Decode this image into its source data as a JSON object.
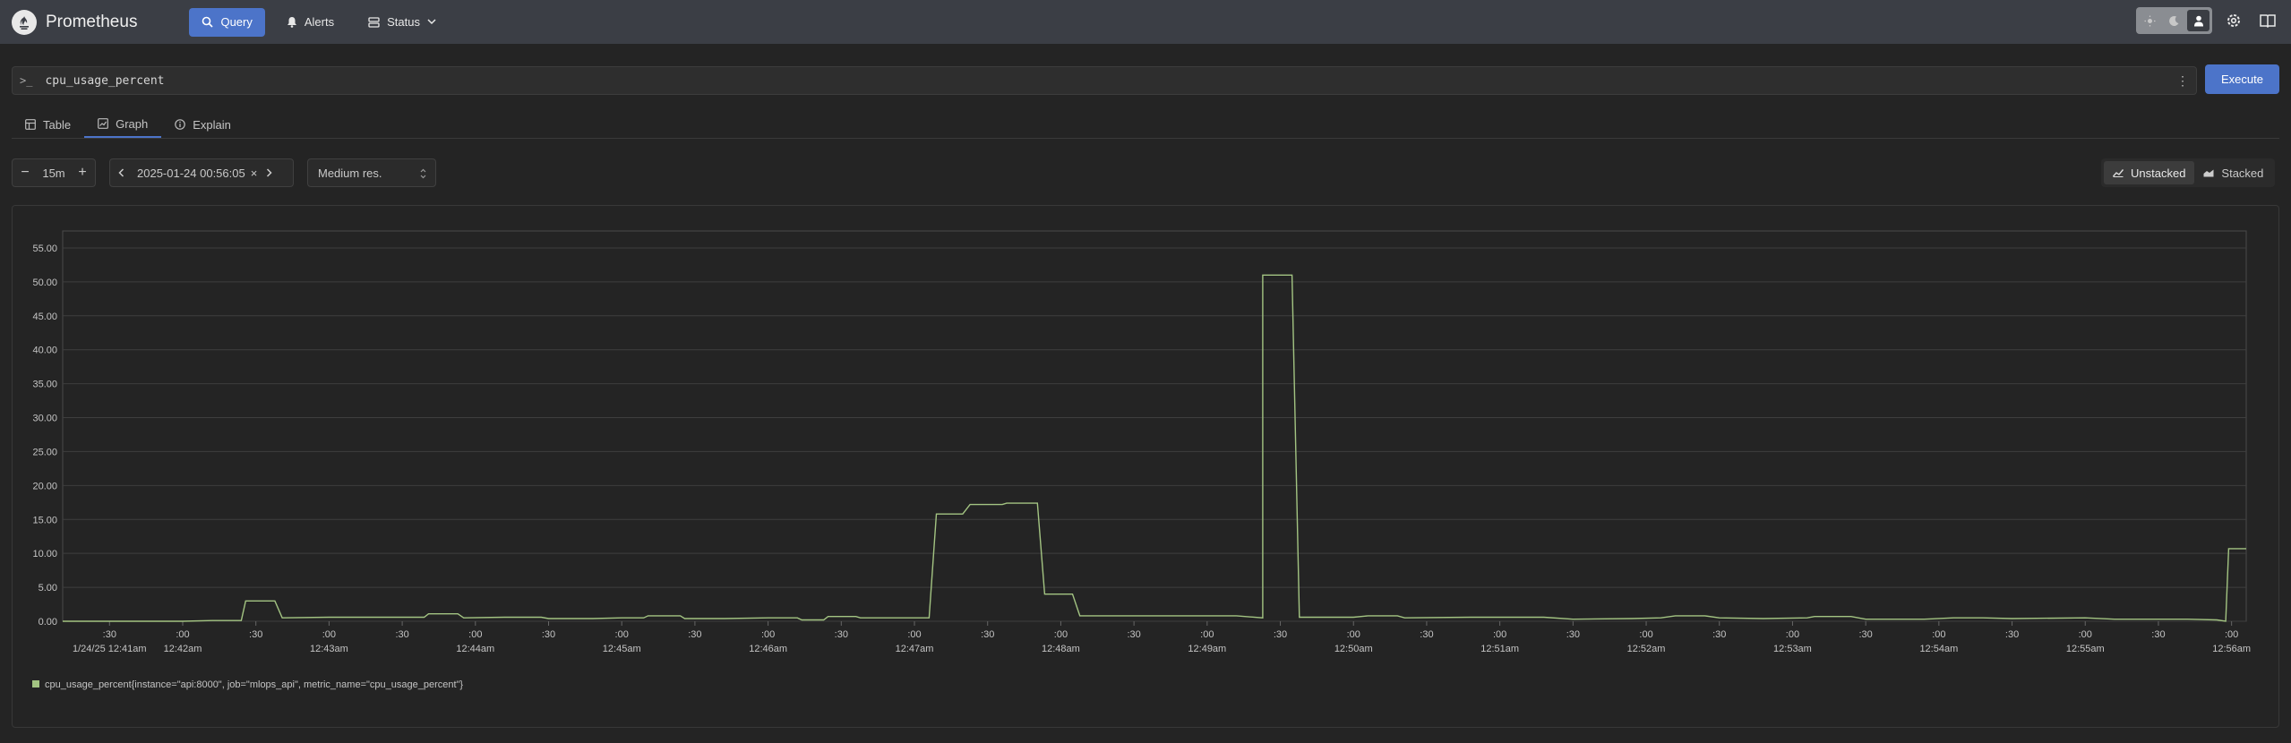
{
  "app": {
    "title": "Prometheus"
  },
  "nav": {
    "query": "Query",
    "alerts": "Alerts",
    "status": "Status"
  },
  "theme": {
    "modes": [
      "light-icon",
      "dark-icon",
      "auto-icon"
    ],
    "selected": "auto"
  },
  "expression": {
    "prompt": ">_",
    "value": "cpu_usage_percent"
  },
  "execute_label": "Execute",
  "tabs": [
    {
      "label": "Table",
      "icon": "table-icon"
    },
    {
      "label": "Graph",
      "icon": "graph-icon",
      "active": true
    },
    {
      "label": "Explain",
      "icon": "info-icon"
    }
  ],
  "controls": {
    "range": "15m",
    "end_time": "2025-01-24 00:56:05",
    "resolution": "Medium res.",
    "unstacked": "Unstacked",
    "stacked": "Stacked",
    "stack_mode": "Unstacked"
  },
  "colors": {
    "accent": "#4c74c9",
    "series": "#a3c482"
  },
  "chart_data": {
    "type": "line",
    "ylim": [
      0,
      57.5
    ],
    "yticks": [
      "0.00",
      "5.00",
      "10.00",
      "15.00",
      "20.00",
      "25.00",
      "30.00",
      "35.00",
      "40.00",
      "45.00",
      "50.00",
      "55.00"
    ],
    "xticks": [
      {
        "t": 0.5,
        "top": ":30",
        "bottom": "1/24/25 12:41am"
      },
      {
        "t": 1.0,
        "top": ":00",
        "bottom": "12:42am"
      },
      {
        "t": 1.5,
        "top": ":30",
        "bottom": ""
      },
      {
        "t": 2.0,
        "top": ":00",
        "bottom": "12:43am"
      },
      {
        "t": 2.5,
        "top": ":30",
        "bottom": ""
      },
      {
        "t": 3.0,
        "top": ":00",
        "bottom": "12:44am"
      },
      {
        "t": 3.5,
        "top": ":30",
        "bottom": ""
      },
      {
        "t": 4.0,
        "top": ":00",
        "bottom": "12:45am"
      },
      {
        "t": 4.5,
        "top": ":30",
        "bottom": ""
      },
      {
        "t": 5.0,
        "top": ":00",
        "bottom": "12:46am"
      },
      {
        "t": 5.5,
        "top": ":30",
        "bottom": ""
      },
      {
        "t": 6.0,
        "top": ":00",
        "bottom": "12:47am"
      },
      {
        "t": 6.5,
        "top": ":30",
        "bottom": ""
      },
      {
        "t": 7.0,
        "top": ":00",
        "bottom": "12:48am"
      },
      {
        "t": 7.5,
        "top": ":30",
        "bottom": ""
      },
      {
        "t": 8.0,
        "top": ":00",
        "bottom": "12:49am"
      },
      {
        "t": 8.5,
        "top": ":30",
        "bottom": ""
      },
      {
        "t": 9.0,
        "top": ":00",
        "bottom": "12:50am"
      },
      {
        "t": 9.5,
        "top": ":30",
        "bottom": ""
      },
      {
        "t": 10.0,
        "top": ":00",
        "bottom": "12:51am"
      },
      {
        "t": 10.5,
        "top": ":30",
        "bottom": ""
      },
      {
        "t": 11.0,
        "top": ":00",
        "bottom": "12:52am"
      },
      {
        "t": 11.5,
        "top": ":30",
        "bottom": ""
      },
      {
        "t": 12.0,
        "top": ":00",
        "bottom": "12:53am"
      },
      {
        "t": 12.5,
        "top": ":30",
        "bottom": ""
      },
      {
        "t": 13.0,
        "top": ":00",
        "bottom": "12:54am"
      },
      {
        "t": 13.5,
        "top": ":30",
        "bottom": ""
      },
      {
        "t": 14.0,
        "top": ":00",
        "bottom": "12:55am"
      },
      {
        "t": 14.5,
        "top": ":30",
        "bottom": ""
      },
      {
        "t": 15.0,
        "top": ":00",
        "bottom": "12:56am"
      }
    ],
    "x_domain": [
      0.18,
      15.1
    ],
    "series": [
      {
        "name": "cpu_usage_percent{instance=\"api:8000\", job=\"mlops_api\", metric_name=\"cpu_usage_percent\"}",
        "points": [
          [
            0.18,
            0.0
          ],
          [
            1.0,
            0.0
          ],
          [
            1.2,
            0.1
          ],
          [
            1.4,
            0.1
          ],
          [
            1.43,
            3.0
          ],
          [
            1.63,
            3.0
          ],
          [
            1.68,
            0.5
          ],
          [
            2.0,
            0.6
          ],
          [
            2.5,
            0.6
          ],
          [
            2.65,
            0.6
          ],
          [
            2.68,
            1.1
          ],
          [
            2.88,
            1.1
          ],
          [
            2.92,
            0.5
          ],
          [
            3.2,
            0.6
          ],
          [
            3.45,
            0.6
          ],
          [
            3.5,
            0.4
          ],
          [
            3.8,
            0.4
          ],
          [
            4.0,
            0.5
          ],
          [
            4.15,
            0.5
          ],
          [
            4.18,
            0.8
          ],
          [
            4.4,
            0.8
          ],
          [
            4.43,
            0.4
          ],
          [
            4.7,
            0.4
          ],
          [
            5.0,
            0.5
          ],
          [
            5.2,
            0.5
          ],
          [
            5.23,
            0.2
          ],
          [
            5.38,
            0.2
          ],
          [
            5.41,
            0.7
          ],
          [
            5.6,
            0.7
          ],
          [
            5.63,
            0.5
          ],
          [
            6.1,
            0.5
          ],
          [
            6.15,
            15.8
          ],
          [
            6.33,
            15.8
          ],
          [
            6.38,
            17.2
          ],
          [
            6.6,
            17.2
          ],
          [
            6.63,
            17.4
          ],
          [
            6.84,
            17.4
          ],
          [
            6.89,
            4.0
          ],
          [
            7.08,
            4.0
          ],
          [
            7.13,
            0.8
          ],
          [
            8.2,
            0.8
          ],
          [
            8.38,
            0.5
          ],
          [
            8.38,
            51.0
          ],
          [
            8.58,
            51.0
          ],
          [
            8.63,
            0.6
          ],
          [
            9.0,
            0.6
          ],
          [
            9.1,
            0.8
          ],
          [
            9.3,
            0.8
          ],
          [
            9.35,
            0.5
          ],
          [
            9.8,
            0.6
          ],
          [
            10.3,
            0.6
          ],
          [
            10.5,
            0.3
          ],
          [
            10.9,
            0.4
          ],
          [
            11.1,
            0.5
          ],
          [
            11.2,
            0.8
          ],
          [
            11.4,
            0.8
          ],
          [
            11.5,
            0.5
          ],
          [
            11.8,
            0.4
          ],
          [
            12.1,
            0.5
          ],
          [
            12.15,
            0.7
          ],
          [
            12.4,
            0.7
          ],
          [
            12.5,
            0.3
          ],
          [
            12.9,
            0.3
          ],
          [
            13.1,
            0.5
          ],
          [
            13.3,
            0.5
          ],
          [
            13.5,
            0.4
          ],
          [
            14.0,
            0.5
          ],
          [
            14.2,
            0.3
          ],
          [
            14.7,
            0.3
          ],
          [
            14.9,
            0.2
          ],
          [
            14.96,
            0.0
          ],
          [
            14.98,
            10.7
          ],
          [
            15.1,
            10.7
          ]
        ]
      }
    ]
  }
}
